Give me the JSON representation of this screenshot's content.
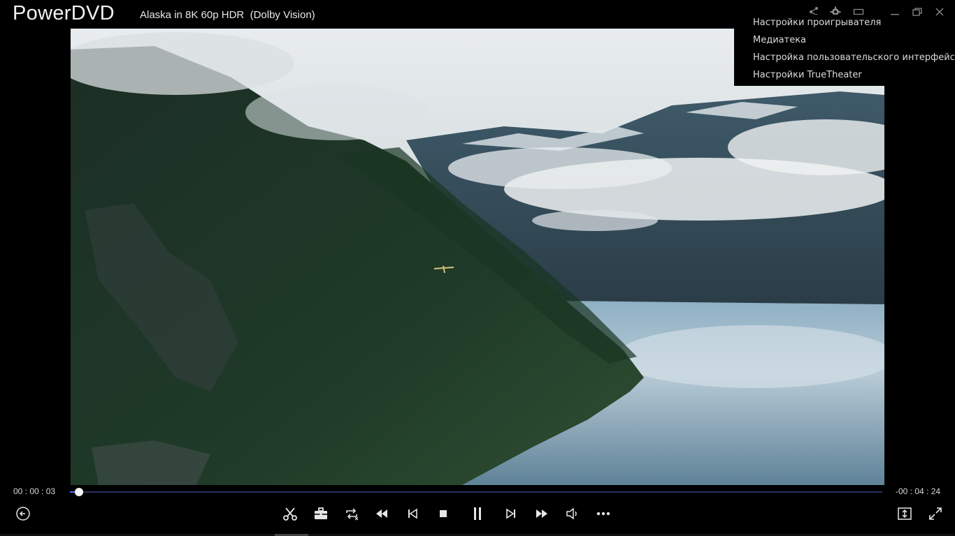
{
  "app": {
    "name": "PowerDVD",
    "media_title": "Alaska in 8K 60p HDR  (Dolby Vision)"
  },
  "titlebar_icons": [
    "share-icon",
    "settings-icon",
    "mini-mode-icon",
    "minimize-icon",
    "restore-icon",
    "close-icon"
  ],
  "settings_menu": {
    "items": [
      {
        "label": "Настройки проигрывателя"
      },
      {
        "label": "Медиатека"
      },
      {
        "label": "Настройка пользовательского интерфейса"
      },
      {
        "label": "Настройки TrueTheater"
      }
    ]
  },
  "playback": {
    "elapsed": "00 : 00 : 03",
    "remaining": "-00 : 04 : 24",
    "progress_fraction": 0.011
  },
  "controls": [
    "back-icon",
    "scissors-icon",
    "toolbox-icon",
    "repeat-icon",
    "rewind-icon",
    "previous-icon",
    "stop-icon",
    "pause-icon",
    "next-icon",
    "fast-forward-icon",
    "volume-icon",
    "more-icon",
    "fit-screen-icon",
    "fullscreen-icon"
  ],
  "colors": {
    "seek_track": "#2b2e5c",
    "seek_fill": "#5a6cff",
    "background": "#000000"
  }
}
